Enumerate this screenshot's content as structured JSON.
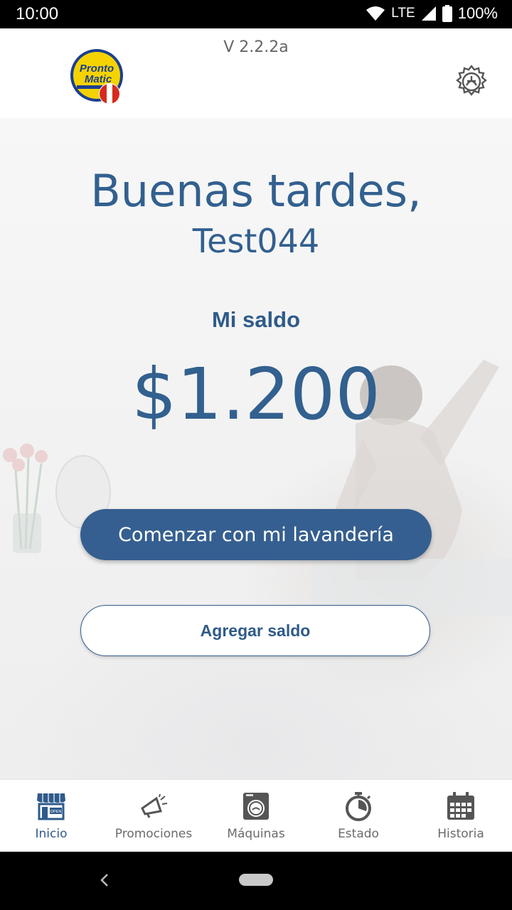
{
  "status_bar": {
    "time": "10:00",
    "network": "LTE",
    "battery": "100%"
  },
  "header": {
    "version": "V 2.2.2a",
    "logo_text_line1": "Pronto",
    "logo_text_line2": "Matic"
  },
  "main": {
    "greeting": "Buenas tardes,",
    "username": "Test044",
    "balance_label": "Mi saldo",
    "balance_value": "$1.200",
    "primary_button": "Comenzar con mi lavandería",
    "secondary_button": "Agregar saldo"
  },
  "nav": {
    "items": [
      {
        "label": "Inicio",
        "icon": "store-open-icon",
        "active": true
      },
      {
        "label": "Promociones",
        "icon": "megaphone-icon"
      },
      {
        "label": "Máquinas",
        "icon": "washing-machine-icon"
      },
      {
        "label": "Estado",
        "icon": "timer-icon"
      },
      {
        "label": "Historia",
        "icon": "calendar-icon"
      }
    ]
  },
  "colors": {
    "brand_blue": "#355f90",
    "text_blue": "#32608f",
    "inactive_gray": "#6b6b6b"
  }
}
